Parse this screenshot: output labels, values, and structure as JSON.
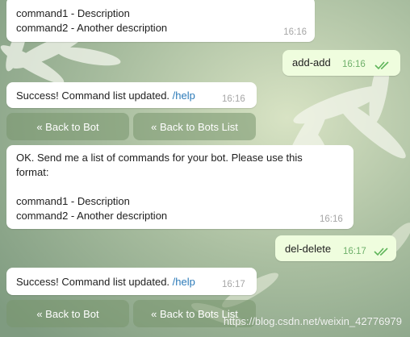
{
  "chat": {
    "msg1": {
      "line1": "command1 - Description",
      "line2": "command2 - Another description",
      "time": "16:16"
    },
    "msg2": {
      "text": "add-add",
      "time": "16:16"
    },
    "msg3": {
      "text": "Success! Command list updated. ",
      "link": "/help",
      "time": "16:16"
    },
    "keyboard1": {
      "back_to_bot": "« Back to Bot",
      "back_to_bots_list": "« Back to Bots List"
    },
    "msg4": {
      "line1": "OK. Send me a list of commands for your bot. Please use this",
      "line2": "format:",
      "line3": "command1 - Description",
      "line4": "command2 - Another description",
      "time": "16:16"
    },
    "msg5": {
      "text": "del-delete",
      "time": "16:17"
    },
    "msg6": {
      "text": "Success! Command list updated. ",
      "link": "/help",
      "time": "16:17"
    },
    "keyboard2": {
      "back_to_bot": "« Back to Bot",
      "back_to_bots_list": "« Back to Bots List"
    }
  },
  "watermark": "https://blog.csdn.net/weixin_42776979",
  "colors": {
    "outgoing_bubble": "#effdde",
    "incoming_bubble": "#ffffff",
    "link": "#2b7ab8",
    "read_ticks": "#5fb55a"
  }
}
